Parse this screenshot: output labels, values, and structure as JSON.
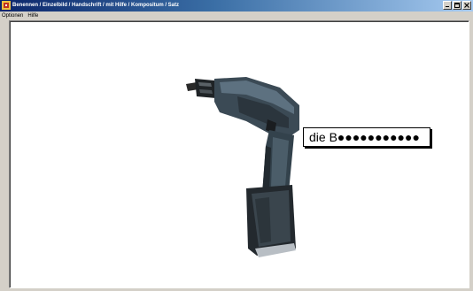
{
  "window": {
    "title": "Benennen / Einzelbild / Handschrift / mit Hilfe / Kompositum / Satz"
  },
  "menu": {
    "items": [
      {
        "label": "Optionen"
      },
      {
        "label": "Hilfe"
      }
    ]
  },
  "exercise": {
    "image_icon": "cordless-drill",
    "answer_text": "die B●●●●●●●●●●●"
  }
}
